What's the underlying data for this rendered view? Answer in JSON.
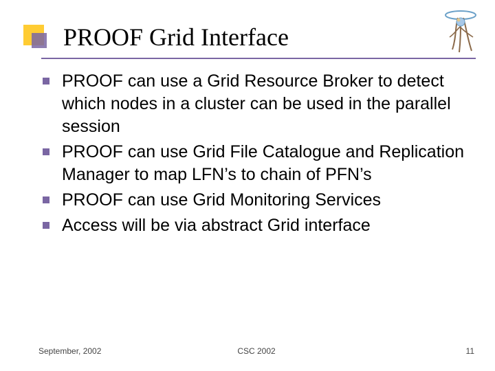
{
  "slide": {
    "title": "PROOF Grid Interface",
    "bullets": [
      "PROOF can use a Grid Resource Broker to detect which nodes in a cluster can be used in the parallel session",
      "PROOF can use Grid File Catalogue and Replication Manager to map LFN’s to chain of PFN’s",
      "PROOF can use Grid Monitoring Services",
      "Access will be via abstract Grid interface"
    ]
  },
  "footer": {
    "left": "September, 2002",
    "center": "CSC 2002",
    "right": "11"
  },
  "icons": {
    "corner": "corner-accent",
    "logo": "root-logo"
  }
}
